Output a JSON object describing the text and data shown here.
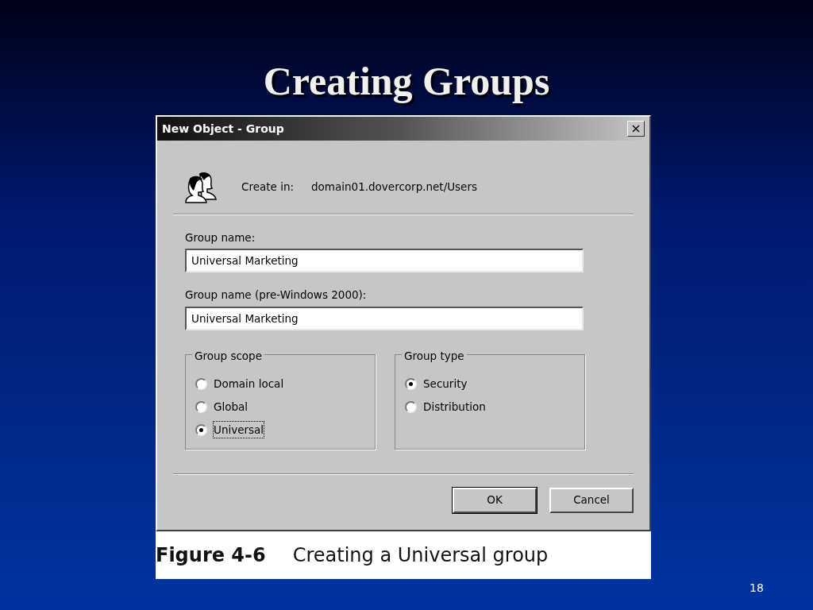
{
  "slide": {
    "title": "Creating Groups",
    "page_number": "18"
  },
  "window": {
    "title": "New Object - Group",
    "close": "×"
  },
  "create_in": {
    "label": "Create in:",
    "value": "domain01.dovercorp.net/Users"
  },
  "fields": [
    {
      "label": "Group name:",
      "value": "Universal Marketing"
    },
    {
      "label": "Group name (pre-Windows 2000):",
      "value": "Universal Marketing"
    }
  ],
  "groups": [
    {
      "title": "Group scope",
      "options": [
        {
          "label": "Domain local",
          "selected": false,
          "focused": false
        },
        {
          "label": "Global",
          "selected": false,
          "focused": false
        },
        {
          "label": "Universal",
          "selected": true,
          "focused": true
        }
      ]
    },
    {
      "title": "Group type",
      "options": [
        {
          "label": "Security",
          "selected": true,
          "focused": false
        },
        {
          "label": "Distribution",
          "selected": false,
          "focused": false
        }
      ]
    }
  ],
  "buttons": [
    {
      "label": "OK",
      "default": true
    },
    {
      "label": "Cancel",
      "default": false
    }
  ],
  "caption": {
    "number": "Figure 4-6",
    "text": "Creating a Universal group"
  }
}
